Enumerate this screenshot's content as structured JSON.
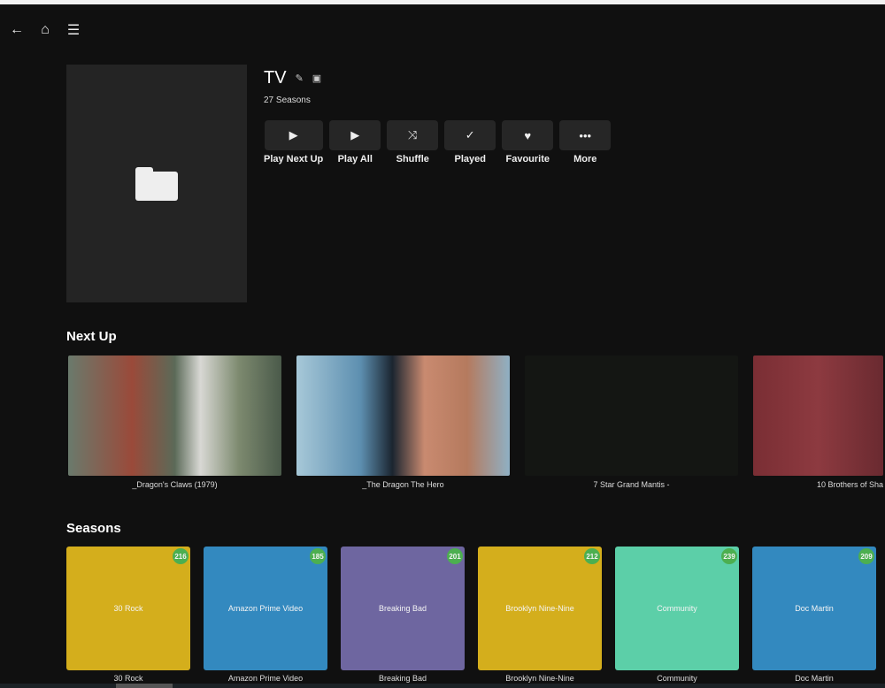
{
  "header": {
    "back_icon": "arrow-left",
    "home_icon": "home",
    "menu_icon": "hamburger"
  },
  "item": {
    "title": "TV",
    "subtitle": "27 Seasons",
    "poster_icon": "folder"
  },
  "actions": [
    {
      "label": "Play Next Up",
      "icon": "▶"
    },
    {
      "label": "Play All",
      "icon": "▶"
    },
    {
      "label": "Shuffle",
      "icon": "⤨"
    },
    {
      "label": "Played",
      "icon": "✓"
    },
    {
      "label": "Favourite",
      "icon": "♥"
    },
    {
      "label": "More",
      "icon": "•••"
    }
  ],
  "next_up": {
    "heading": "Next Up",
    "items": [
      {
        "title": "_Dragon's Claws (1979)"
      },
      {
        "title": "_The Dragon The Hero"
      },
      {
        "title": "7 Star Grand Mantis -"
      },
      {
        "title": "10 Brothers of Sha"
      }
    ]
  },
  "seasons": {
    "heading": "Seasons",
    "items": [
      {
        "name": "30 Rock",
        "count": "216",
        "color": "#d4ae1c"
      },
      {
        "name": "Amazon Prime Video",
        "count": "185",
        "color": "#3389bf"
      },
      {
        "name": "Breaking Bad",
        "count": "201",
        "color": "#6e66a0"
      },
      {
        "name": "Brooklyn Nine-Nine",
        "count": "212",
        "color": "#d4ae1c"
      },
      {
        "name": "Community",
        "count": "239",
        "color": "#5ccfa8"
      },
      {
        "name": "Doc Martin",
        "count": "209",
        "color": "#3389bf"
      }
    ]
  }
}
